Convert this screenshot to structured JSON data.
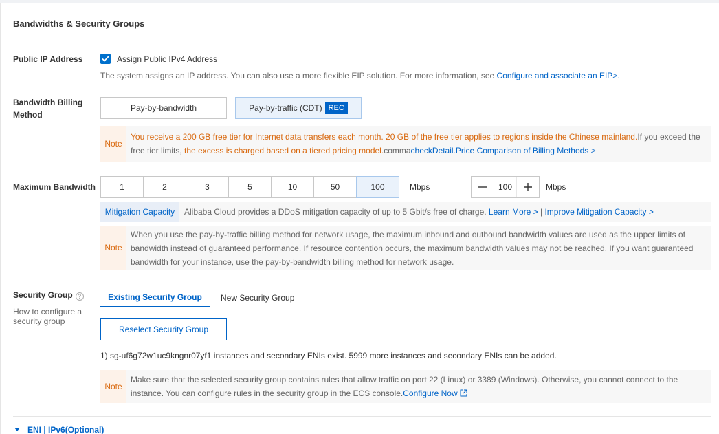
{
  "section": {
    "title": "Bandwidths & Security Groups"
  },
  "public_ip": {
    "label": "Public IP Address",
    "checkbox_label": "Assign Public IPv4 Address",
    "checked": true,
    "description": "The system assigns an IP address. You can also use a more flexible EIP solution. For more information, see",
    "link": "Configure and associate an EIP>."
  },
  "billing": {
    "label_line1": "Bandwidth Billing",
    "label_line2": "Method",
    "options": [
      "Pay-by-bandwidth",
      "Pay-by-traffic (CDT)"
    ],
    "selected": "Pay-by-traffic (CDT)",
    "rec_badge": "REC",
    "note_tag": "Note",
    "note_orange1": "You receive a 200 GB free tier for Internet data transfers each month. 20 GB of the free tier applies to regions inside the Chinese mainland.",
    "note_plain1": "If you exceed the",
    "note_plain2": "free tier limits, ",
    "note_orange2": "the excess is charged based on a tiered pricing model.",
    "note_plain3": "comma",
    "note_link": "checkDetail.Price Comparison of Billing Methods >"
  },
  "max_bandwidth": {
    "label": "Maximum Bandwidth",
    "options": [
      "1",
      "2",
      "3",
      "5",
      "10",
      "50",
      "100"
    ],
    "selected": "100",
    "unit": "Mbps",
    "stepper_minus": "—",
    "stepper_value": "100",
    "stepper_plus": "+",
    "stepper_unit": "Mbps",
    "mitigation_tag": "Mitigation Capacity",
    "mitigation_text": "Alibaba Cloud provides a DDoS mitigation capacity of up to 5 Gbit/s free of charge.",
    "learn_more": "Learn More >",
    "separator": "|",
    "improve_link": "Improve Mitigation Capacity >",
    "note_tag": "Note",
    "note_line1": "When you use the pay-by-traffic billing method for network usage, the maximum inbound and outbound bandwidth values are used as the upper limits of",
    "note_line2": "bandwidth instead of guaranteed performance. If resource contention occurs, the maximum bandwidth values may not be reached. If you want guaranteed",
    "note_line3": "bandwidth for your instance, use the pay-by-bandwidth billing method for network usage."
  },
  "security_group": {
    "label": "Security Group",
    "help_icon": "?",
    "sub_label_line1": "How to configure a",
    "sub_label_line2": "security group",
    "tabs": [
      "Existing Security Group",
      "New Security Group"
    ],
    "active_tab": "Existing Security Group",
    "reselect_button": "Reselect Security Group",
    "group_info": "1) sg-uf6g72w1uc9kngnr07yf1 instances and secondary ENIs exist. 5999 more instances and secondary ENIs can be added.",
    "note_tag": "Note",
    "note_line1": "Make sure that the selected security group contains rules that allow traffic on port 22 (Linux) or 3389 (Windows). Otherwise, you cannot connect to the",
    "note_line2": "instance. You can configure rules in the security group in the ECS console.",
    "note_link": "Configure Now"
  },
  "eni": {
    "label": "ENI | IPv6(Optional)"
  },
  "colors": {
    "accent": "#0064c8",
    "note_orange": "#d9690f",
    "selected_bg": "#eaf2fb"
  },
  "icons": {
    "checkbox": "check-icon",
    "external_link": "external-link-icon",
    "expand": "caret-down-icon"
  }
}
